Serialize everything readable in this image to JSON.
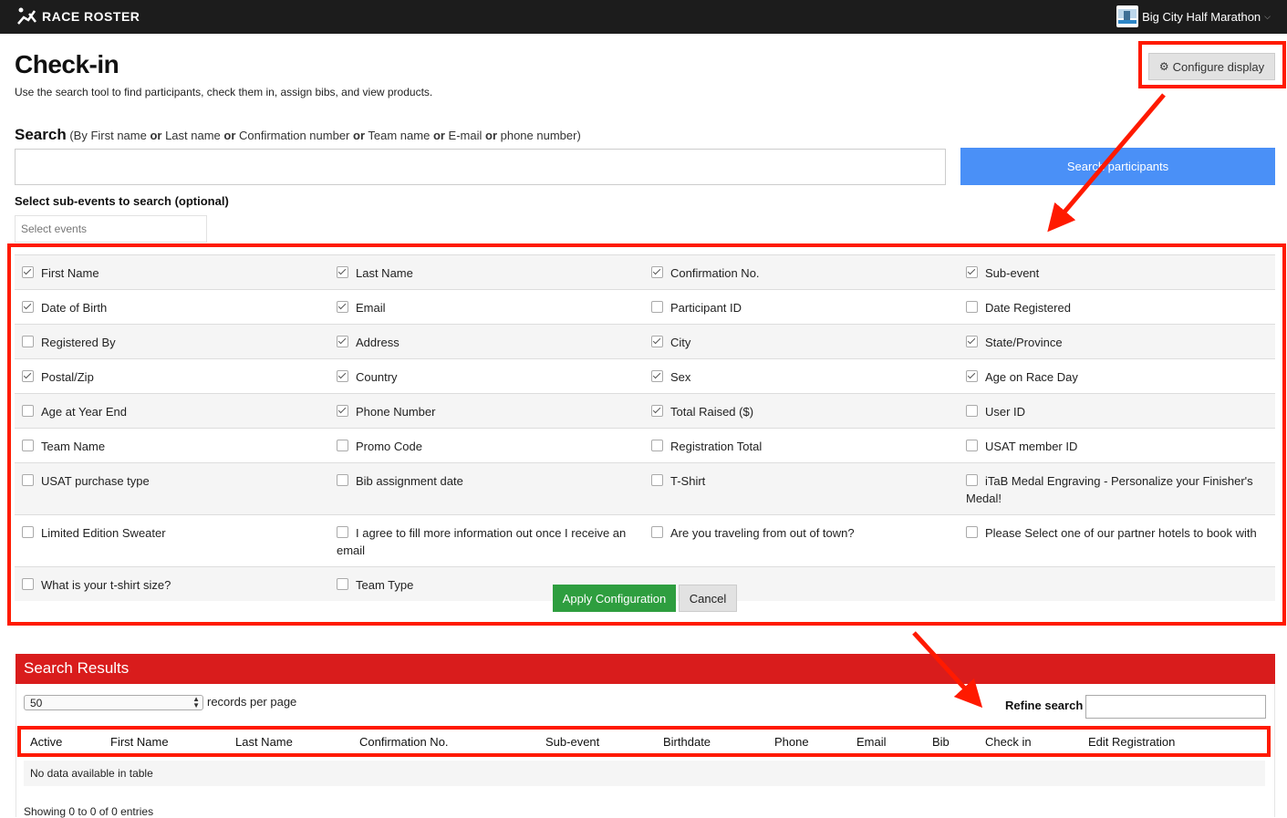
{
  "brand": "RACE ROSTER",
  "event_name": "Big City Half Marathon",
  "page": {
    "title": "Check-in",
    "subtitle": "Use the search tool to find participants, check them in, assign bibs, and view products."
  },
  "configure_display_label": "Configure display",
  "search": {
    "label": "Search",
    "hint_parts": [
      "(By First name ",
      "or",
      " Last name ",
      "or",
      " Confirmation number ",
      "or",
      " Team name ",
      "or",
      " E-mail ",
      "or",
      " phone number)"
    ],
    "value": "",
    "button_label": "Search participants",
    "subevents_label": "Select sub-events to search (optional)",
    "subevents_placeholder": "Select events"
  },
  "columns_config": [
    [
      {
        "label": "First Name",
        "checked": true
      },
      {
        "label": "Last Name",
        "checked": true
      },
      {
        "label": "Confirmation No.",
        "checked": true
      },
      {
        "label": "Sub-event",
        "checked": true
      }
    ],
    [
      {
        "label": "Date of Birth",
        "checked": true
      },
      {
        "label": "Email",
        "checked": true
      },
      {
        "label": "Participant ID",
        "checked": false
      },
      {
        "label": "Date Registered",
        "checked": false
      }
    ],
    [
      {
        "label": "Registered By",
        "checked": false
      },
      {
        "label": "Address",
        "checked": true
      },
      {
        "label": "City",
        "checked": true
      },
      {
        "label": "State/Province",
        "checked": true
      }
    ],
    [
      {
        "label": "Postal/Zip",
        "checked": true
      },
      {
        "label": "Country",
        "checked": true
      },
      {
        "label": "Sex",
        "checked": true
      },
      {
        "label": "Age on Race Day",
        "checked": true
      }
    ],
    [
      {
        "label": "Age at Year End",
        "checked": false
      },
      {
        "label": "Phone Number",
        "checked": true
      },
      {
        "label": "Total Raised ($)",
        "checked": true
      },
      {
        "label": "User ID",
        "checked": false
      }
    ],
    [
      {
        "label": "Team Name",
        "checked": false
      },
      {
        "label": "Promo Code",
        "checked": false
      },
      {
        "label": "Registration Total",
        "checked": false
      },
      {
        "label": "USAT member ID",
        "checked": false
      }
    ],
    [
      {
        "label": "USAT purchase type",
        "checked": false
      },
      {
        "label": "Bib assignment date",
        "checked": false
      },
      {
        "label": "T-Shirt",
        "checked": false
      },
      {
        "label": "iTaB Medal Engraving - Personalize your Finisher's Medal!",
        "checked": false
      }
    ],
    [
      {
        "label": "Limited Edition Sweater",
        "checked": false
      },
      {
        "label": "I agree to fill more information out once I receive an email",
        "checked": false
      },
      {
        "label": "Are you traveling from out of town?",
        "checked": false
      },
      {
        "label": "Please Select one of our partner hotels to book with",
        "checked": false
      }
    ],
    [
      {
        "label": "What is your t-shirt size?",
        "checked": false
      },
      {
        "label": "Team Type",
        "checked": false
      }
    ]
  ],
  "apply_label": "Apply Configuration",
  "cancel_label": "Cancel",
  "results": {
    "title": "Search Results",
    "records_per_page": "50",
    "records_label": "records per page",
    "refine_label": "Refine search",
    "refine_value": "",
    "headers": [
      "Active",
      "First Name",
      "Last Name",
      "Confirmation No.",
      "Sub-event",
      "Birthdate",
      "Phone",
      "Email",
      "Bib",
      "Check in",
      "Edit Registration"
    ],
    "empty_text": "No data available in table",
    "showing_text": "Showing 0 to 0 of 0 entries"
  },
  "colors": {
    "topbar": "#1c1c1c",
    "annotation_red": "#ff1a00",
    "search_button": "#4a90f7",
    "apply_button": "#2e9e3f",
    "results_header": "#d91c1c"
  }
}
